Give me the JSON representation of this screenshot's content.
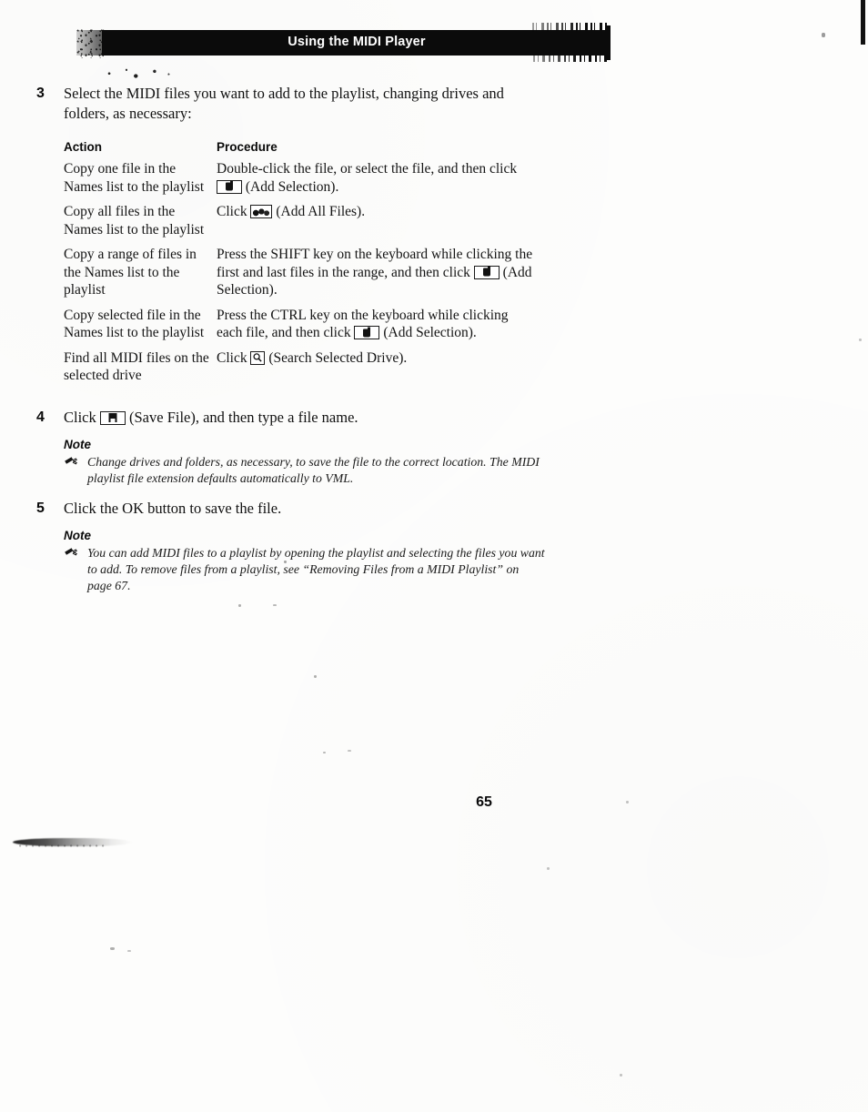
{
  "header": {
    "title": "Using the MIDI Player"
  },
  "steps": [
    {
      "number": "3",
      "text": "Select the MIDI files you want to add to the playlist, changing drives and folders, as necessary:"
    },
    {
      "number": "4",
      "text_before": "Click",
      "icon": "save-file-icon",
      "text_after": "(Save File), and then type a file name."
    },
    {
      "number": "5",
      "text": "Click the OK button to save the file."
    }
  ],
  "procedure_table": {
    "headers": {
      "action": "Action",
      "procedure": "Procedure"
    },
    "rows": [
      {
        "action": "Copy one file in the Names list to the playlist",
        "procedure_before": "Double-click the file, or select the file, and then click",
        "icon": "add-selection-icon",
        "procedure_after": "(Add Selection)."
      },
      {
        "action": "Copy all files in the Names list to the playlist",
        "procedure_before": "Click",
        "icon": "add-all-files-icon",
        "procedure_after": "(Add All Files)."
      },
      {
        "action": "Copy a range of files in the Names list to the playlist",
        "procedure_before": "Press the SHIFT key on the keyboard while clicking the first and last files in the range, and then click",
        "icon": "add-selection-icon",
        "procedure_after": "(Add Selection)."
      },
      {
        "action": "Copy selected file in the Names list to the playlist",
        "procedure_before": "Press the CTRL key on the keyboard while clicking each file, and then click",
        "icon": "add-selection-icon",
        "procedure_after": "(Add Selection)."
      },
      {
        "action": "Find all MIDI files on the selected drive",
        "procedure_before": "Click",
        "icon": "search-selected-drive-icon",
        "procedure_after": "(Search Selected Drive)."
      }
    ]
  },
  "notes": [
    {
      "label": "Note",
      "text": "Change drives and folders, as necessary, to save the file to the correct location. The MIDI playlist file extension defaults automatically to VML."
    },
    {
      "label": "Note",
      "text": "You can add MIDI files to a playlist by opening the playlist and selecting the files you want to add. To remove files from a playlist, see “Removing Files from a MIDI Playlist” on page 67."
    }
  ],
  "footer": {
    "page_number": "65"
  }
}
